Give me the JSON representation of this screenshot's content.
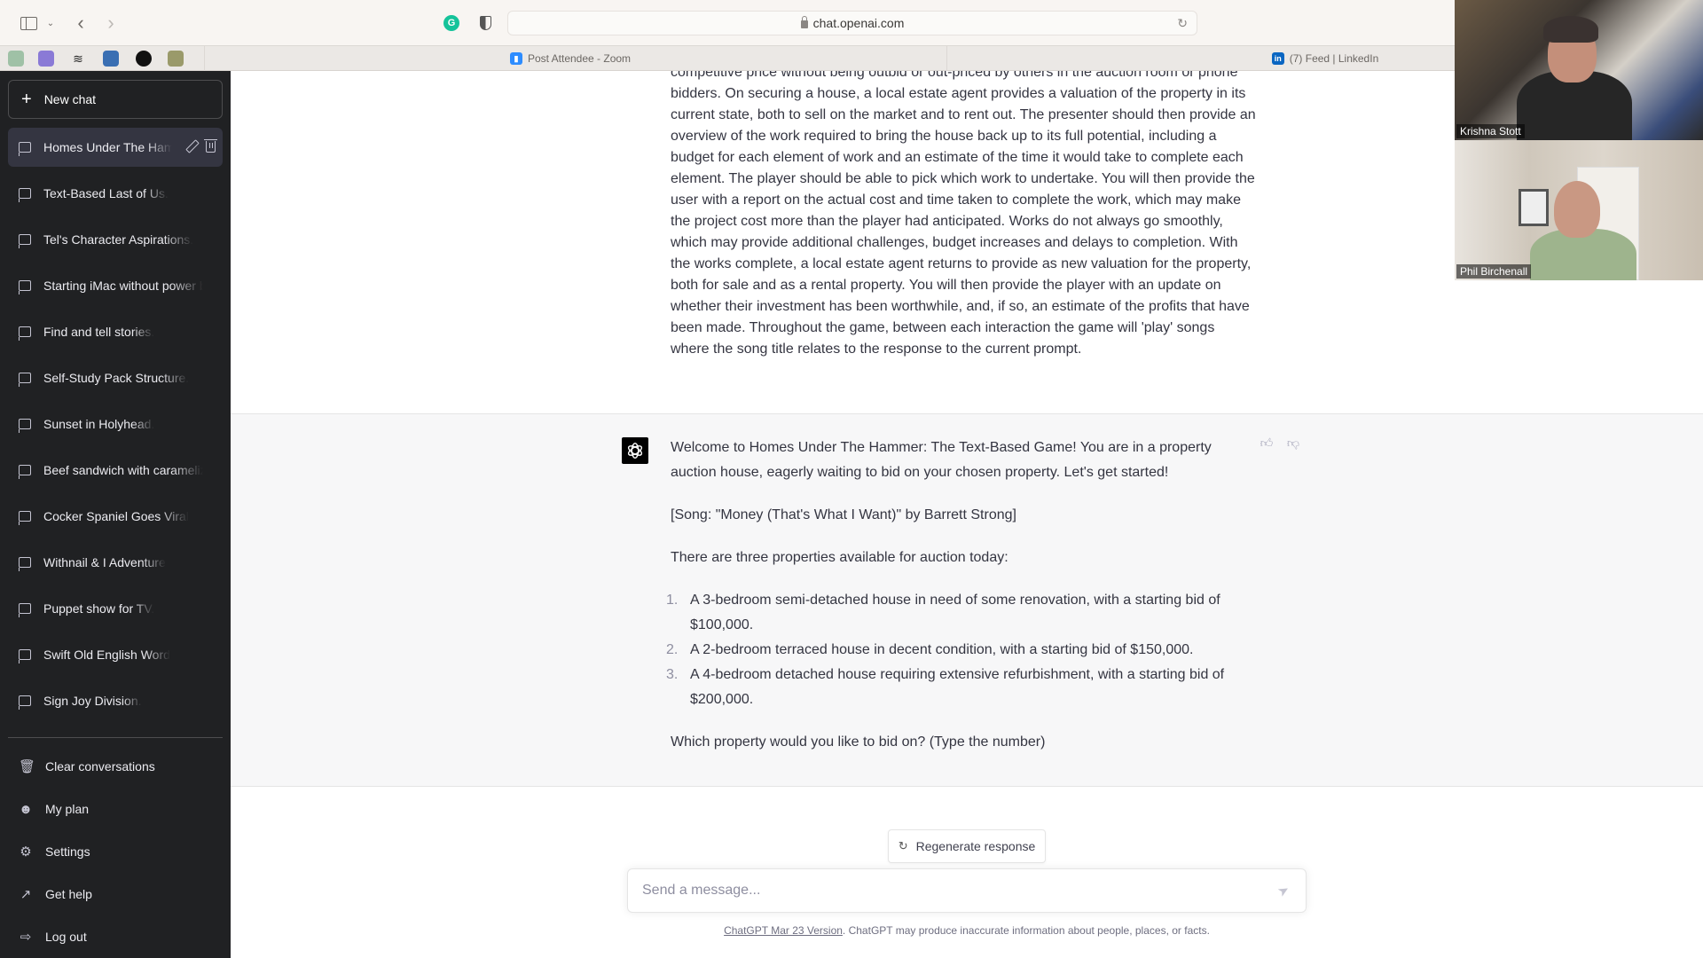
{
  "browser": {
    "url": "chat.openai.com",
    "tabs": [
      {
        "label": "Post Attendee - Zoom",
        "icon": "zoom-icon"
      },
      {
        "label": "(7) Feed | LinkedIn",
        "icon": "linkedin-icon"
      }
    ],
    "favorites": [
      "chatgpt-favicon",
      "app-favicon-purple",
      "squarespace-favicon",
      "app-favicon-blue",
      "app-favicon-black",
      "app-favicon-green"
    ]
  },
  "sidebar": {
    "new_chat": "New chat",
    "conversations": [
      {
        "label": "Homes Under The Hammer: The Text-Based Game",
        "active": true
      },
      {
        "label": "Text-Based Last of Us."
      },
      {
        "label": "Tel's Character Aspirations."
      },
      {
        "label": "Starting iMac without power button"
      },
      {
        "label": "Find and tell stories."
      },
      {
        "label": "Self-Study Pack Structure."
      },
      {
        "label": "Sunset in Holyhead."
      },
      {
        "label": "Beef sandwich with caramelized onions"
      },
      {
        "label": "Cocker Spaniel Goes Viral"
      },
      {
        "label": "Withnail & I Adventure"
      },
      {
        "label": "Puppet show for TV."
      },
      {
        "label": "Swift Old English Word"
      },
      {
        "label": "Sign Joy Division."
      }
    ],
    "menu": [
      {
        "label": "Clear conversations",
        "icon": "trash-icon"
      },
      {
        "label": "My plan",
        "icon": "user-icon"
      },
      {
        "label": "Settings",
        "icon": "gear-icon"
      },
      {
        "label": "Get help",
        "icon": "external-link-icon"
      },
      {
        "label": "Log out",
        "icon": "logout-icon"
      }
    ]
  },
  "chat": {
    "user_message": "competitive price without being outbid or out-priced by others in the auction room or phone bidders. On securing a house, a local estate agent provides a valuation of the property in its current state, both to sell on the market and to rent out. The presenter should then provide an overview of the work required to bring the house back up to its full potential, including a budget for each element of work and an estimate of the time it would take to complete each element. The player should be able to pick which work to undertake. You will then provide the user with a report on the actual cost and time taken to complete the work, which may make the project cost more than the player had anticipated. Works do not always go smoothly, which may provide additional challenges, budget increases and delays to completion. With the works complete, a local estate agent returns to provide as new valuation for the property, both for sale and as a rental property. You will then provide the player with an update on whether their investment has been worthwhile, and, if so, an estimate of the profits that have been made. Throughout the game, between each interaction the game will 'play' songs where the song title relates to the response to the current prompt.",
    "assistant": {
      "intro": "Welcome to Homes Under The Hammer: The Text-Based Game! You are in a property auction house, eagerly waiting to bid on your chosen property. Let's get started!",
      "song": "[Song: \"Money (That's What I Want)\" by Barrett Strong]",
      "list_intro": "There are three properties available for auction today:",
      "properties": [
        {
          "num": "1.",
          "text": "A 3-bedroom semi-detached house in need of some renovation, with a starting bid of $100,000."
        },
        {
          "num": "2.",
          "text": "A 2-bedroom terraced house in decent condition, with a starting bid of $150,000."
        },
        {
          "num": "3.",
          "text": "A 4-bedroom detached house requiring extensive refurbishment, with a starting bid of $200,000."
        }
      ],
      "question": "Which property would you like to bid on? (Type the number)"
    },
    "regenerate": "Regenerate response",
    "input_placeholder": "Send a message...",
    "input_value": "",
    "footer_link": "ChatGPT Mar 23 Version",
    "footer_text": ". ChatGPT may produce inaccurate information about people, places, or facts."
  },
  "video_call": {
    "participants": [
      "Krishna Stott",
      "Phil Birchenall"
    ]
  }
}
